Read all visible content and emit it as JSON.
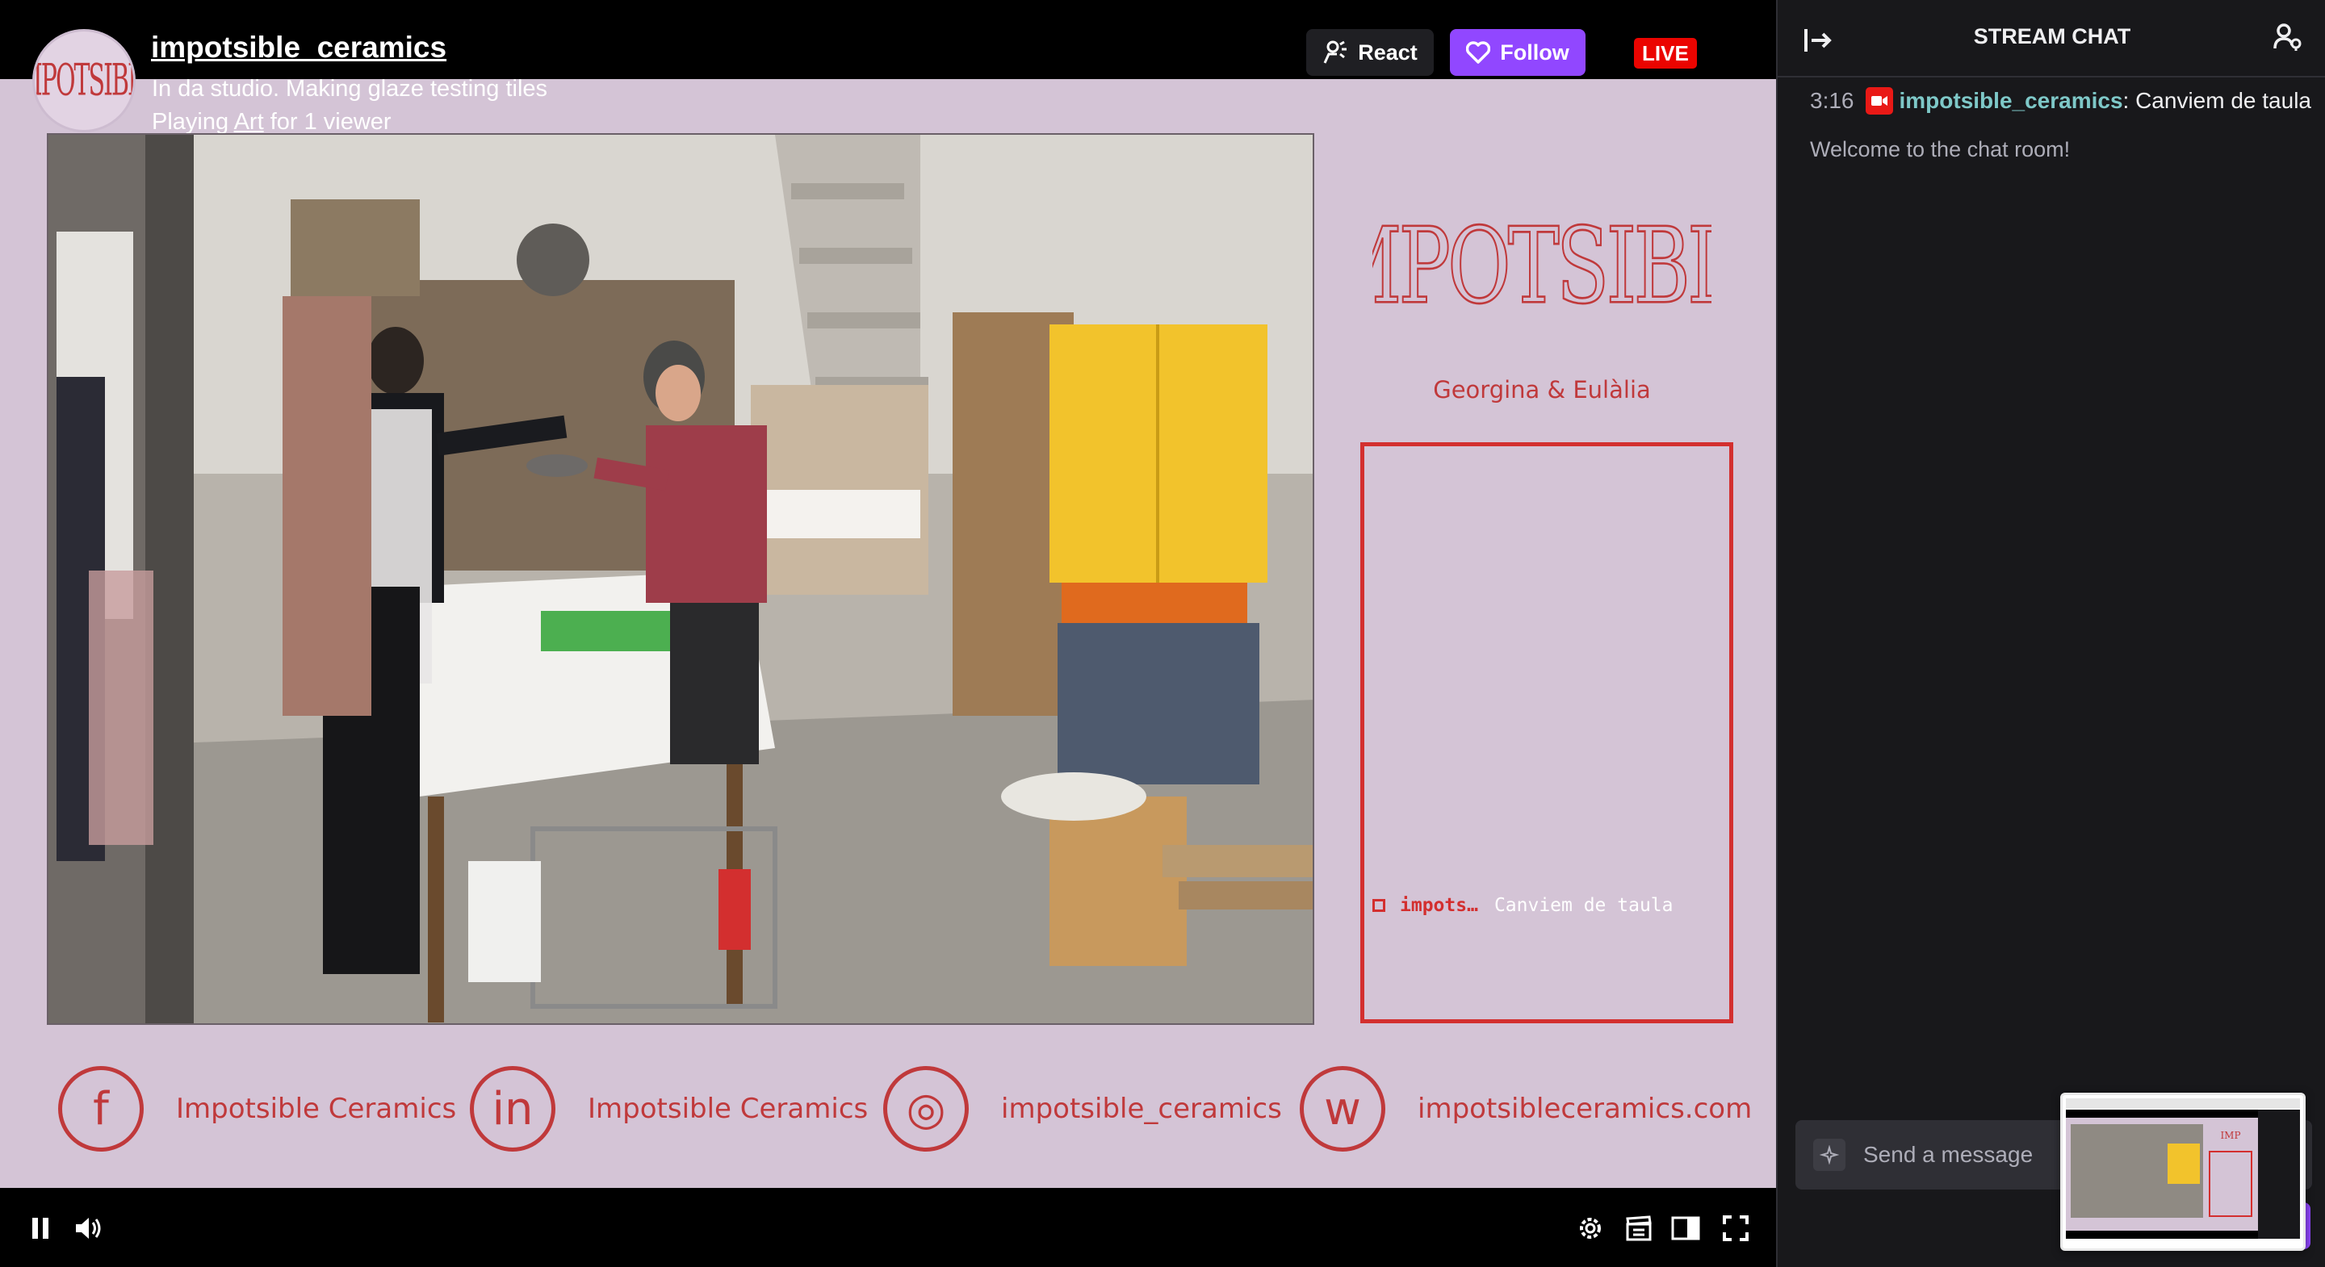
{
  "channel": {
    "name": "impotsible_ceramics",
    "avatar_text": "IMPOTSIBLE",
    "title": "In da studio. Making glaze testing tiles",
    "playing_prefix": "Playing ",
    "category": "Art",
    "playing_suffix": " for 1 viewer"
  },
  "top_actions": {
    "react_label": "React",
    "follow_label": "Follow",
    "live_label": "LIVE"
  },
  "overlay": {
    "brand_logo": "IMPOTSIBLE",
    "brand_names": "Georgina & Eulàlia",
    "chat_user": "impots…",
    "chat_text": "Canviem de taula"
  },
  "socials": [
    {
      "icon": "facebook-icon",
      "glyph": "f",
      "label": "Impotsible Ceramics"
    },
    {
      "icon": "linkedin-icon",
      "glyph": "in",
      "label": "Impotsible Ceramics"
    },
    {
      "icon": "instagram-icon",
      "glyph": "◎",
      "label": "impotsible_ceramics"
    },
    {
      "icon": "web-icon",
      "glyph": "w",
      "label": "impotsibleceramics.com"
    }
  ],
  "chat": {
    "header": "STREAM CHAT",
    "message": {
      "time": "3:16",
      "user": "impotsible_ceramics",
      "text": ": Canviem de taula"
    },
    "welcome": "Welcome to the chat room!",
    "input_placeholder": "Send a message"
  },
  "colors": {
    "accent": "#9147ff",
    "live": "#eb0400",
    "brand_red": "#c0393b",
    "overlay_bg": "#d4c4d6"
  }
}
